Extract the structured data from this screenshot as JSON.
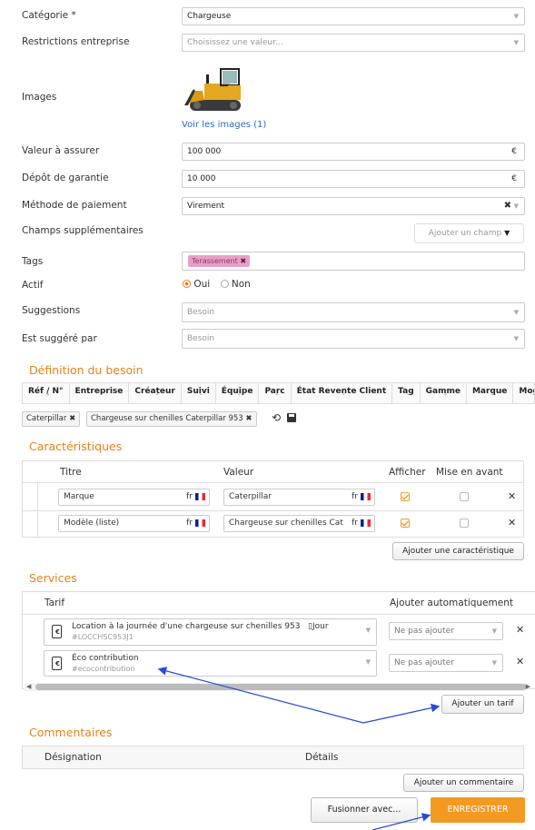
{
  "form": {
    "categorie": {
      "label": "Catégorie *",
      "value": "Chargeuse"
    },
    "restrictions": {
      "label": "Restrictions entreprise",
      "placeholder": "Choisissez une valeur..."
    },
    "images": {
      "label": "Images",
      "link": "Voir les images (1)"
    },
    "valeur": {
      "label": "Valeur à assurer",
      "value": "100 000",
      "currency": "€"
    },
    "depot": {
      "label": "Dépôt de garantie",
      "value": "10 000",
      "currency": "€"
    },
    "paiement": {
      "label": "Méthode de paiement",
      "value": "Virement"
    },
    "champs": {
      "label": "Champs supplémentaires",
      "button": "Ajouter un champ"
    },
    "tags": {
      "label": "Tags",
      "tag": "Terassement"
    },
    "actif": {
      "label": "Actif",
      "oui": "Oui",
      "non": "Non"
    },
    "suggestions": {
      "label": "Suggestions",
      "placeholder": "Besoin"
    },
    "suggere": {
      "label": "Est suggéré par",
      "placeholder": "Besoin"
    }
  },
  "besoin": {
    "title": "Définition du besoin",
    "columns": [
      "Réf / N°",
      "Entreprise",
      "Créateur",
      "Suivi",
      "Équipe",
      "Parc",
      "État Revente Client",
      "Tag",
      "Gamme",
      "Marque",
      "Modè"
    ],
    "chips": [
      "Caterpillar",
      "Chargeuse sur chenilles Caterpillar 953"
    ]
  },
  "caracteristiques": {
    "title": "Caractéristiques",
    "headers": {
      "titre": "Titre",
      "valeur": "Valeur",
      "afficher": "Afficher",
      "mise": "Mise en avant"
    },
    "rows": [
      {
        "titre": "Marque",
        "lang": "fr",
        "valeur": "Caterpillar",
        "afficher": true,
        "mise": false
      },
      {
        "titre": "Modèle (liste)",
        "lang": "fr",
        "valeur": "Chargeuse sur chenilles Cat",
        "afficher": true,
        "mise": false
      }
    ],
    "add_button": "Ajouter une caractéristique"
  },
  "services": {
    "title": "Services",
    "headers": {
      "tarif": "Tarif",
      "auto": "Ajouter automatiquement"
    },
    "rows": [
      {
        "name": "Location à la journée d'une chargeuse sur chenilles 953",
        "unit": "Jour",
        "code": "#LOCCHSC953J1",
        "auto": "Ne pas ajouter"
      },
      {
        "name": "Éco contribution",
        "unit": "",
        "code": "#ecocontribution",
        "auto": "Ne pas ajouter"
      }
    ],
    "add_button": "Ajouter un tarif"
  },
  "commentaires": {
    "title": "Commentaires",
    "headers": {
      "designation": "Désignation",
      "details": "Détails"
    },
    "add_button": "Ajouter un commentaire"
  },
  "footer": {
    "fusionner": "Fusionner avec...",
    "enregistrer": "ENREGISTRER"
  },
  "colors": {
    "accent": "#e8811b",
    "tag_bg": "#e8a0c8",
    "annotation": "#2848d8"
  }
}
